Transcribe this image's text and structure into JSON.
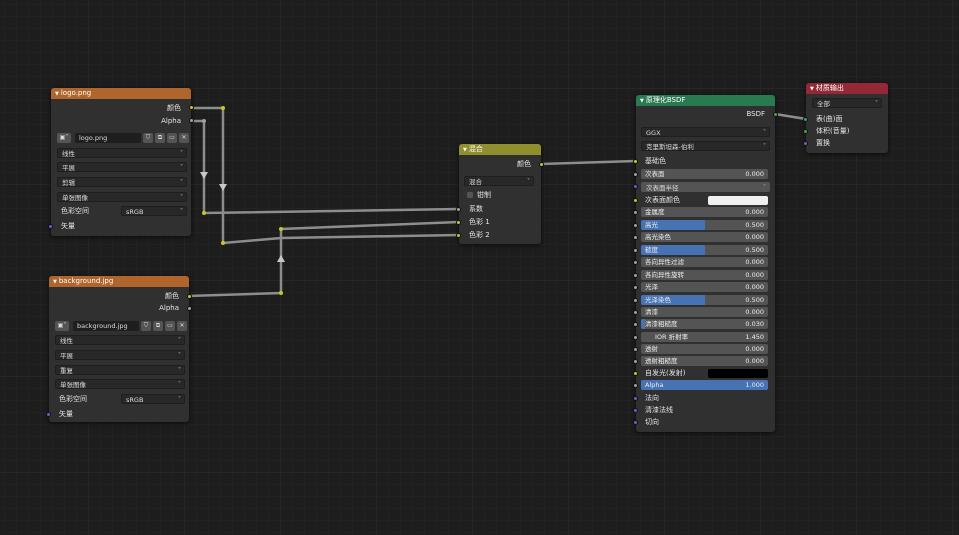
{
  "colors": {
    "texture_header": "#b0652d",
    "mix_header": "#8f8f2d",
    "bsdf_header": "#2a7a51",
    "output_header": "#952836",
    "accent_blue": "#4772b3",
    "link": "#8d8d8d"
  },
  "logo_node": {
    "title": "logo.png",
    "out_color": "颜色",
    "out_alpha": "Alpha",
    "image_name": "logo.png",
    "interpolation": "线性",
    "projection": "平展",
    "extension": "剪辑",
    "source": "单张图像",
    "colorspace_label": "色彩空间",
    "colorspace_value": "sRGB",
    "in_vector": "矢量"
  },
  "bg_node": {
    "title": "background.jpg",
    "out_color": "颜色",
    "out_alpha": "Alpha",
    "image_name": "background.jpg",
    "interpolation": "线性",
    "projection": "平展",
    "extension": "重复",
    "source": "单张图像",
    "colorspace_label": "色彩空间",
    "colorspace_value": "sRGB",
    "in_vector": "矢量"
  },
  "mix_node": {
    "title": "混合",
    "out_color": "颜色",
    "blend_mode": "混合",
    "clamp_label": "钳制",
    "in_fac": "系数",
    "in_color1": "色彩 1",
    "in_color2": "色彩 2"
  },
  "bsdf_node": {
    "title": "原理化BSDF",
    "out_bsdf": "BSDF",
    "distribution": "GGX",
    "subsurface_method": "克里斯坦森-伯利",
    "base_color": "基础色",
    "sss_radius": "次表面半径",
    "sss_color": "次表面颜色",
    "fields": [
      {
        "label": "次表面",
        "value": "0.000",
        "fill": 0
      },
      {
        "label": "金属度",
        "value": "0.000",
        "fill": 0
      },
      {
        "label": "高光",
        "value": "0.500",
        "fill": 0.5
      },
      {
        "label": "高光染色",
        "value": "0.000",
        "fill": 0
      },
      {
        "label": "糙度",
        "value": "0.500",
        "fill": 0.5
      },
      {
        "label": "各向异性过滤",
        "value": "0.000",
        "fill": 0
      },
      {
        "label": "各向异性旋转",
        "value": "0.000",
        "fill": 0
      },
      {
        "label": "光泽",
        "value": "0.000",
        "fill": 0
      },
      {
        "label": "光泽染色",
        "value": "0.500",
        "fill": 0.5
      },
      {
        "label": "清漆",
        "value": "0.000",
        "fill": 0
      },
      {
        "label": "清漆粗糙度",
        "value": "0.030",
        "fill": 0
      },
      {
        "label": "IOR 折射率",
        "value": "1.450",
        "fill": 0
      },
      {
        "label": "透射",
        "value": "0.000",
        "fill": 0
      },
      {
        "label": "透射粗糙度",
        "value": "0.000",
        "fill": 0
      }
    ],
    "emission": "自发光(发射)",
    "alpha": {
      "label": "Alpha",
      "value": "1.000",
      "fill": 1
    },
    "normal": "法向",
    "clearcoat_normal": "清漆法线",
    "tangent": "切向"
  },
  "output_node": {
    "title": "材质输出",
    "target": "全部",
    "in_surface": "表(曲)面",
    "in_volume": "体积(音量)",
    "in_displacement": "置换"
  }
}
